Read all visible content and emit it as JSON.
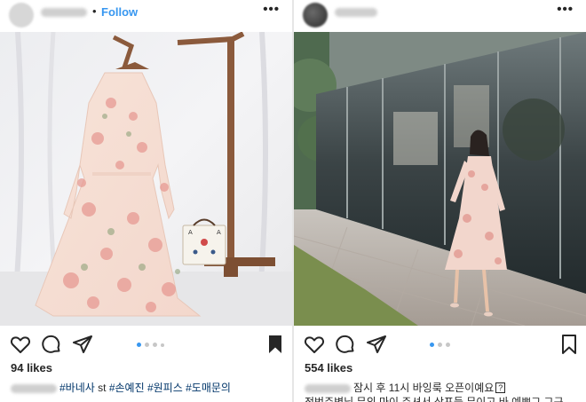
{
  "left_post": {
    "follow_label": "Follow",
    "more_label": "•••",
    "likes": "94 likes",
    "caption_text": "#바네사 st #손예진 #원피스 #도매문의",
    "caption_parts": [
      "#바네사",
      "st",
      "#손예진",
      "#원피스",
      "#도매문의"
    ],
    "carousel": {
      "count": 4,
      "active": 1
    },
    "icons": [
      "heart-icon",
      "comment-icon",
      "share-icon",
      "bookmark-icon"
    ]
  },
  "right_post": {
    "more_label": "•••",
    "likes": "554 likes",
    "caption_text": "잠시 후 11시 바잉룩 오픈이예요",
    "caption_line2": "전번주변님 무의 마이 주셔서 상프들 무이고 바 예쁘그 그구",
    "carousel": {
      "count": 3,
      "active": 1
    },
    "icons": [
      "heart-icon",
      "comment-icon",
      "share-icon",
      "bookmark-icon"
    ]
  },
  "colors": {
    "link_blue": "#3897f0",
    "hashtag": "#003569",
    "text": "#262626",
    "inactive_dot": "#c7c7c7"
  }
}
